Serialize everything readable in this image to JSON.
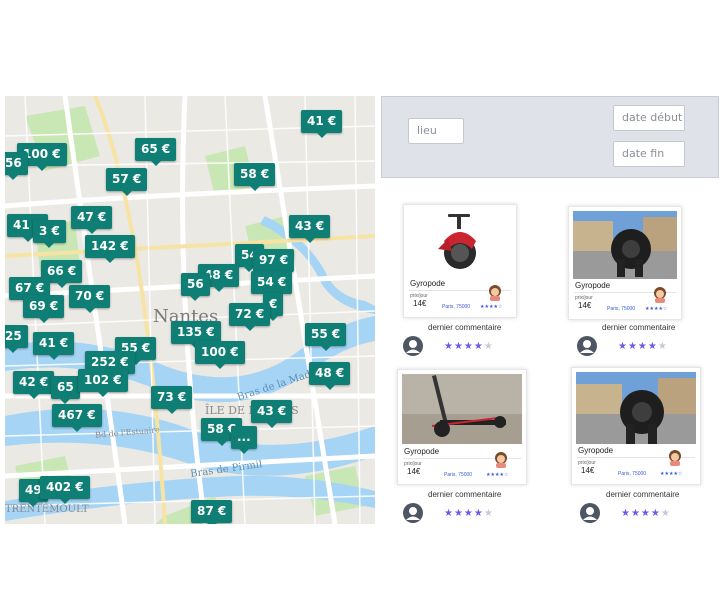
{
  "map": {
    "labels": {
      "city": "Nantes",
      "district": "ÎLE DE NANTES",
      "suburb": "TRENTEMOULT",
      "river1": "Bras de la Madeleine",
      "river2": "Bras de Pirmil",
      "street": "Bd de l'Estuaire"
    },
    "pins": [
      {
        "label": "41 €"
      },
      {
        "label": "100 €"
      },
      {
        "label": "65 €"
      },
      {
        "label": "56"
      },
      {
        "label": "57 €"
      },
      {
        "label": "58 €"
      },
      {
        "label": "47 €"
      },
      {
        "label": "41 €"
      },
      {
        "label": "3 €"
      },
      {
        "label": "142 €"
      },
      {
        "label": "43 €"
      },
      {
        "label": "54"
      },
      {
        "label": "97 €"
      },
      {
        "label": "66 €"
      },
      {
        "label": "48 €"
      },
      {
        "label": "56"
      },
      {
        "label": "67 €"
      },
      {
        "label": "70 €"
      },
      {
        "label": "54 €"
      },
      {
        "label": "69 €"
      },
      {
        "label": "€"
      },
      {
        "label": "72 €"
      },
      {
        "label": "135 €"
      },
      {
        "label": "55 €"
      },
      {
        "label": "25"
      },
      {
        "label": "41 €"
      },
      {
        "label": "55 €"
      },
      {
        "label": "100 €"
      },
      {
        "label": "252 €"
      },
      {
        "label": "42 €"
      },
      {
        "label": "65"
      },
      {
        "label": "102 €"
      },
      {
        "label": "48 €"
      },
      {
        "label": "73 €"
      },
      {
        "label": "467 €"
      },
      {
        "label": "43 €"
      },
      {
        "label": "58 €"
      },
      {
        "label": "..."
      },
      {
        "label": "49"
      },
      {
        "label": "402 €"
      },
      {
        "label": "87 €"
      }
    ]
  },
  "filter": {
    "lieu_placeholder": "lieu",
    "date_debut_placeholder": "date début",
    "date_fin_placeholder": "date fin"
  },
  "cards": [
    {
      "name": "Gyropode",
      "price_label": "prix/jour",
      "price": "14€",
      "paris": "Paris, 75000",
      "comment": "dernier commentaire",
      "rating": 4,
      "photo": "monowheel"
    },
    {
      "name": "Gyropode",
      "price_label": "prix/jour",
      "price": "14€",
      "paris": "Paris, 75000",
      "comment": "dernier commentaire",
      "rating": 4,
      "photo": "wheel-street"
    },
    {
      "name": "Gyropode",
      "price_label": "prix/jour",
      "price": "14€",
      "paris": "Paris, 75000",
      "comment": "dernier commentaire",
      "rating": 4,
      "photo": "scooter"
    },
    {
      "name": "Gyropode",
      "price_label": "prix/jour",
      "price": "14€",
      "paris": "Paris, 75000",
      "comment": "dernier commentaire",
      "rating": 4,
      "photo": "wheel-street"
    }
  ],
  "colors": {
    "pin": "#0f7e74",
    "filter_bg": "#dfe3e9",
    "star_on": "#6b5ce7",
    "star_off": "#c9c9d6"
  },
  "icons": [
    "user-icon",
    "star-icon",
    "avatar-icon"
  ]
}
